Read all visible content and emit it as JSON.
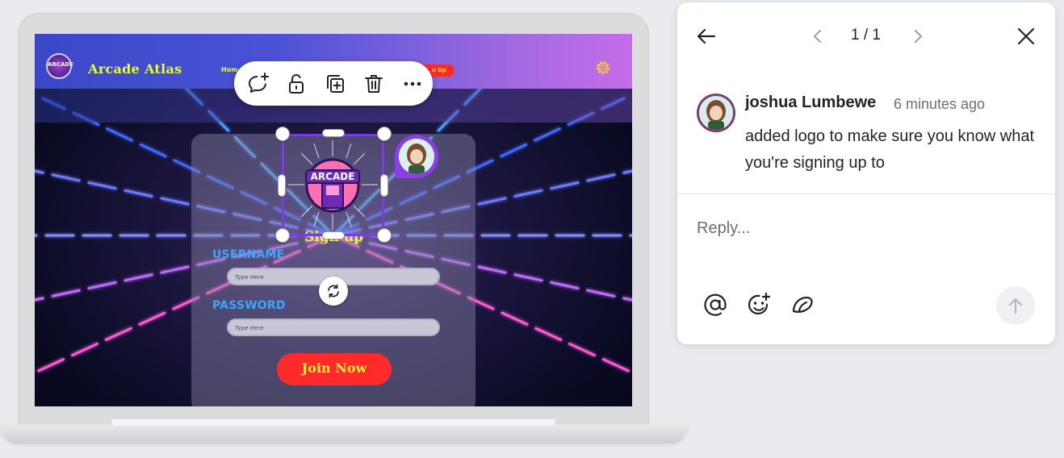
{
  "site": {
    "logo_text": "ARCADE",
    "title": "Arcade Atlas",
    "nav_home": "Hom",
    "nav_signup": "n Up"
  },
  "card": {
    "title": "Sign up",
    "username_label": "USERNAME",
    "username_placeholder": "Type Here",
    "password_label": "PASSWORD",
    "password_placeholder": "Type Here",
    "join_label": "Join Now"
  },
  "selected_element": {
    "logo_text": "ARCADE"
  },
  "toolbar": {
    "icons": [
      "comment-add-icon",
      "unlock-icon",
      "duplicate-icon",
      "trash-icon",
      "more-icon"
    ]
  },
  "comment_panel": {
    "pager": "1 / 1",
    "author": "joshua Lumbewe",
    "time": "6 minutes ago",
    "message": "added logo to make sure you know what you're signing up to",
    "reply_placeholder": "Reply..."
  },
  "colors": {
    "accent": "#7c3cdc",
    "site_title": "#e8ff2a",
    "label_blue": "#3aa7ff",
    "cta_red": "#ff2a2a"
  }
}
